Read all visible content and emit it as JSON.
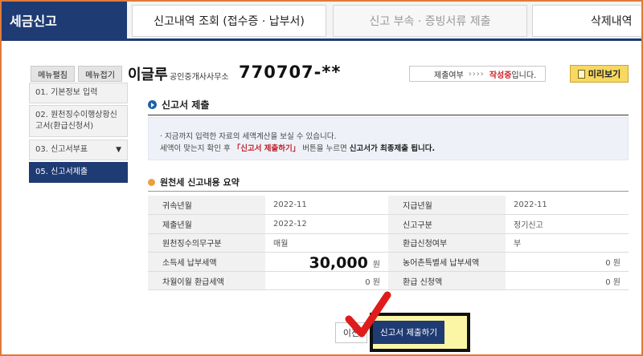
{
  "tabs": [
    {
      "label": "세금신고",
      "active": true
    },
    {
      "label": "신고내역 조회 (접수증 · 납부서)"
    },
    {
      "label": "신고 부속 · 증빙서류 제출",
      "disabled": true
    },
    {
      "label": "삭제내역"
    }
  ],
  "header": {
    "expand_label": "메뉴펼침",
    "collapse_label": "메뉴접기",
    "name": "이글루",
    "office": "공인중개사사무소",
    "reg_no": "770707-**",
    "status_label": "제출여부",
    "status_arrows": "›››› ",
    "status_value": "작성중",
    "status_suffix": "입니다.",
    "preview_label": "미리보기"
  },
  "sidebar": {
    "items": [
      {
        "label": "01. 기본정보 입력"
      },
      {
        "label": "02. 원천징수이행상황신고서(환급신청서)"
      },
      {
        "label": "03. 신고서부표"
      },
      {
        "label": "05. 신고서제출",
        "active": true
      }
    ]
  },
  "main": {
    "title": "신고서 제출",
    "notice": {
      "line1": "· 지금까지 입력한 자료의 세액계산을 보실 수 있습니다.",
      "line2_pre": "  세액이 맞는지 확인 후 ",
      "line2_red": "「신고서 제출하기」",
      "line2_mid": " 버튼을 누르면 ",
      "line2_bold": "신고서가 최종제출 됩니다."
    },
    "summary_title": "원천세 신고내용 요약",
    "rows": [
      {
        "l1": "귀속년월",
        "v1": "2022-11",
        "l2": "지급년월",
        "v2": "2022-11"
      },
      {
        "l1": "제출년월",
        "v1": "2022-12",
        "l2": "신고구분",
        "v2": "정기신고"
      },
      {
        "l1": "원천징수의무구분",
        "v1": "매월",
        "l2": "환급신청여부",
        "v2": "부"
      },
      {
        "l1": "소득세 납부세액",
        "v1": "30,000",
        "u1": "원",
        "l2": "농어촌특별세 납부세액",
        "v2": "0",
        "u2": "원"
      },
      {
        "l1": "차월이월 환급세액",
        "v1": "0",
        "u1": "원",
        "l2": "환급 신청액",
        "v2": "0",
        "u2": "원"
      }
    ],
    "prev_label": "이전",
    "submit_label": "신고서 제출하기"
  },
  "colors": {
    "brand": "#1f3b73",
    "accent_red": "#d0202a",
    "highlight": "#fbf6a6",
    "checkmark": "#e01b1b"
  }
}
